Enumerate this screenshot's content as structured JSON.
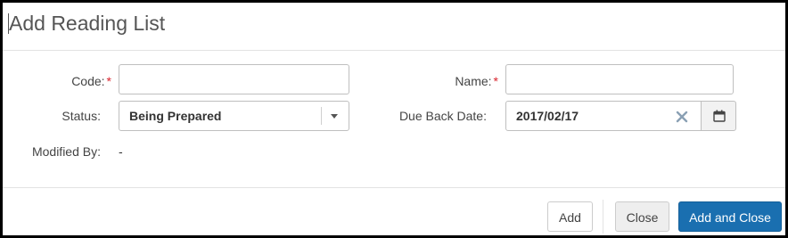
{
  "dialog": {
    "title": "Add Reading List"
  },
  "form": {
    "code": {
      "label": "Code:",
      "required_mark": "*",
      "value": ""
    },
    "name": {
      "label": "Name:",
      "required_mark": "*",
      "value": ""
    },
    "status": {
      "label": "Status:",
      "selected": "Being Prepared"
    },
    "due_back_date": {
      "label": "Due Back Date:",
      "value": "2017/02/17"
    },
    "modified_by": {
      "label": "Modified By:",
      "value": "-"
    }
  },
  "footer": {
    "add_label": "Add",
    "close_label": "Close",
    "add_and_close_label": "Add and Close"
  },
  "colors": {
    "required": "#d9232d",
    "primary_button": "#1a6fb0",
    "clear_icon": "#8aa0b4"
  },
  "icons": {
    "clear": "close-x-icon",
    "calendar": "calendar-icon",
    "dropdown": "caret-down-icon"
  }
}
